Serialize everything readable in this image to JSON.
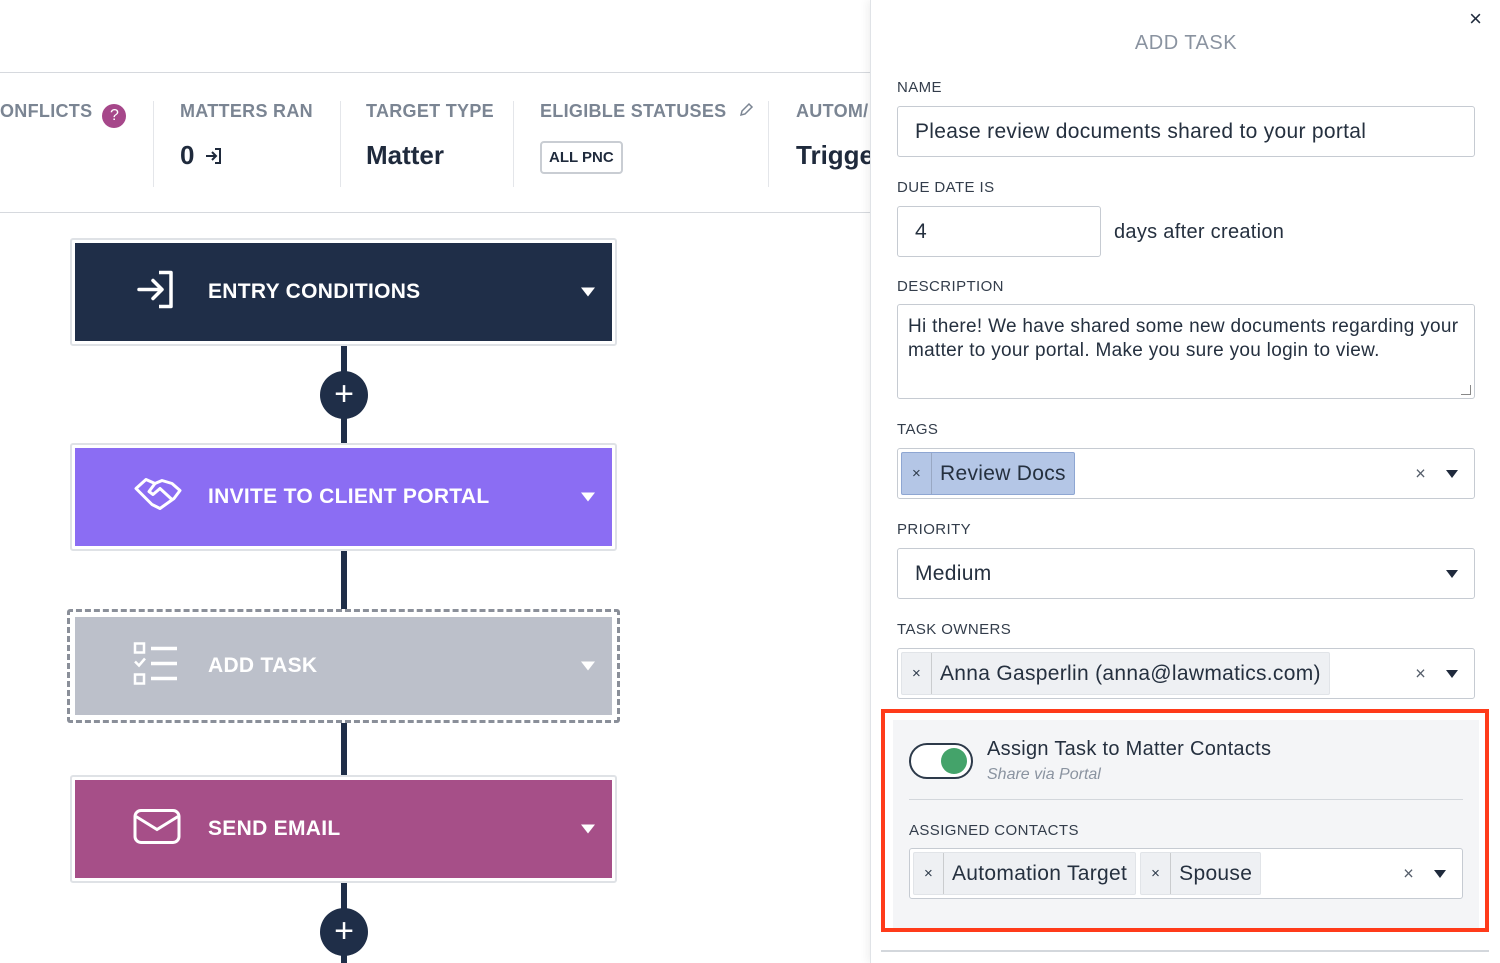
{
  "stats": {
    "conflicts_label": "ONFLICTS",
    "conflicts_help": "?",
    "matters_ran_label": "MATTERS RAN",
    "matters_ran_value": "0",
    "target_type_label": "TARGET TYPE",
    "target_type_value": "Matter",
    "eligible_statuses_label": "ELIGIBLE STATUSES",
    "eligible_statuses_value": "ALL PNC",
    "automation_label": "AUTOM/",
    "automation_value": "Trigge"
  },
  "flow": {
    "cards": [
      {
        "title": "ENTRY CONDITIONS",
        "icon": "enter-icon",
        "color": "#1f2e48"
      },
      {
        "title": "INVITE TO CLIENT PORTAL",
        "icon": "handshake-icon",
        "color": "#8b6df3"
      },
      {
        "title": "ADD TASK",
        "icon": "checklist-icon",
        "color": "#bcc0ca"
      },
      {
        "title": "SEND EMAIL",
        "icon": "envelope-icon",
        "color": "#a64f88"
      }
    ],
    "plus": "+"
  },
  "panel": {
    "title": "ADD TASK",
    "close": "×",
    "name_label": "NAME",
    "name_value": "Please review documents shared to your portal",
    "due_label": "DUE DATE IS",
    "due_value": "4",
    "due_suffix": "days after creation",
    "description_label": "DESCRIPTION",
    "description_value": "Hi there! We have shared some new documents regarding your matter to your portal. Make you sure you login to view.",
    "tags_label": "TAGS",
    "tags": [
      "Review Docs"
    ],
    "priority_label": "PRIORITY",
    "priority_value": "Medium",
    "owners_label": "TASK OWNERS",
    "owners": [
      "Anna Gasperlin (anna@lawmatics.com)"
    ],
    "assign_label": "Assign Task to Matter Contacts",
    "assign_sub": "Share via Portal",
    "assign_on": true,
    "contacts_label": "ASSIGNED CONTACTS",
    "contacts": [
      "Automation Target",
      "Spouse"
    ],
    "chip_remove": "×",
    "clear": "×"
  },
  "colors": {
    "navy": "#1f2e48",
    "purple": "#8b6df3",
    "grey": "#bcc0ca",
    "magenta": "#a64f88",
    "highlight": "#ff3b1a",
    "toggle_on": "#44a36a",
    "tag_chip": "#b4c6e6"
  }
}
